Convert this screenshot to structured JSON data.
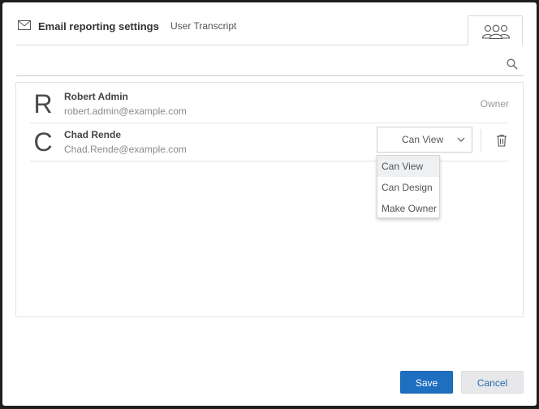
{
  "header": {
    "title": "Email reporting settings",
    "separator": "-",
    "subtitle": "User Transcript",
    "tab_icon": "users-group-icon"
  },
  "search": {
    "placeholder": "",
    "value": ""
  },
  "users": [
    {
      "initial": "R",
      "name": "Robert Admin",
      "email": "robert.admin@example.com",
      "role": "Owner"
    },
    {
      "initial": "C",
      "name": "Chad Rende",
      "email": "Chad.Rende@example.com",
      "permission": "Can View"
    }
  ],
  "permission_menu": {
    "options": [
      "Can View",
      "Can Design",
      "Make Owner"
    ],
    "highlighted": "Can View"
  },
  "footer": {
    "save_label": "Save",
    "cancel_label": "Cancel"
  },
  "colors": {
    "primary": "#1f6fc0",
    "secondary_bg": "#e6e8ea",
    "link": "#2a68b0"
  }
}
